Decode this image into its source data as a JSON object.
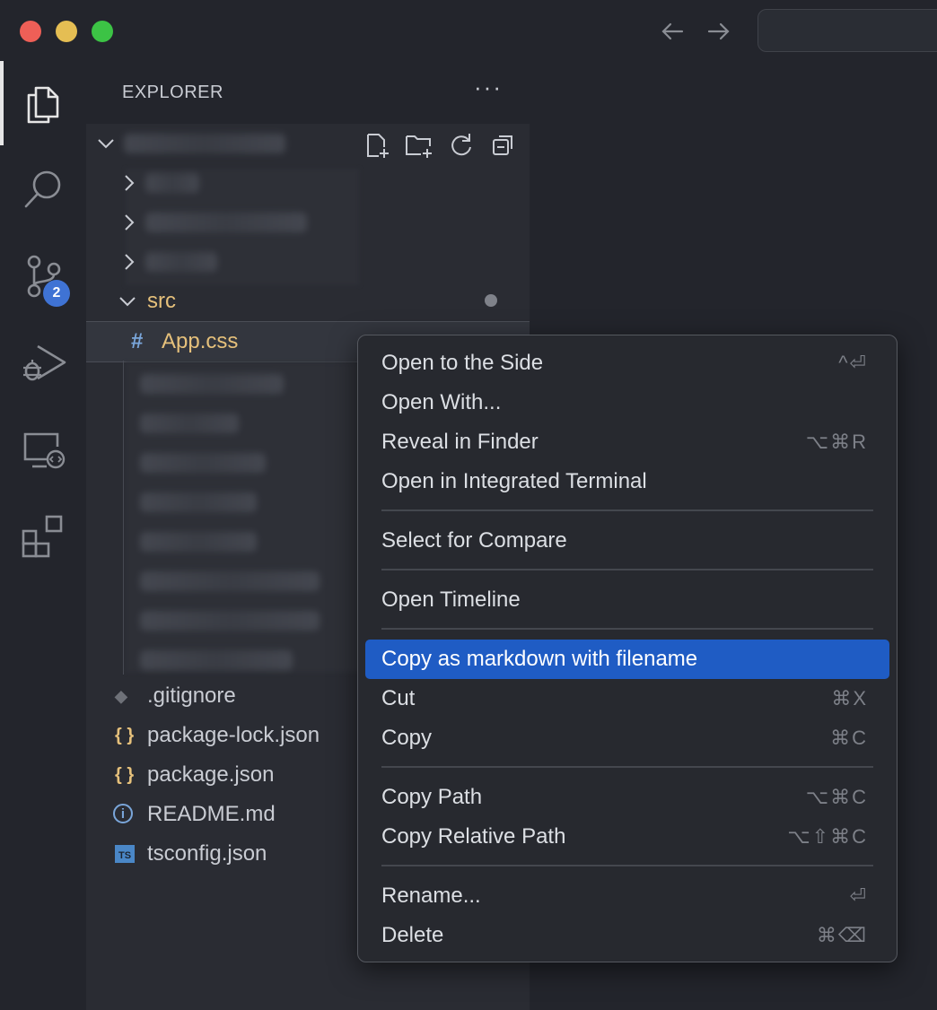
{
  "sidebar": {
    "title": "EXPLORER",
    "more": "···",
    "src_folder": "src",
    "selected_file": {
      "icon": "#",
      "name": "App.css"
    },
    "files": [
      {
        "icon": "◆",
        "name": ".gitignore",
        "icon_name": "git-icon"
      },
      {
        "icon": "{ }",
        "name": "package-lock.json",
        "icon_name": "json-icon"
      },
      {
        "icon": "{ }",
        "name": "package.json",
        "icon_name": "json-icon"
      },
      {
        "icon": "i",
        "name": "README.md",
        "icon_name": "info-icon"
      },
      {
        "icon": "TS",
        "name": "tsconfig.json",
        "icon_name": "typescript-icon"
      }
    ]
  },
  "activity_bar": {
    "source_control_badge": "2"
  },
  "context_menu": {
    "items": [
      {
        "label": "Open to the Side",
        "shortcut": "^⏎"
      },
      {
        "label": "Open With...",
        "shortcut": ""
      },
      {
        "label": "Reveal in Finder",
        "shortcut": "⌥⌘R"
      },
      {
        "label": "Open in Integrated Terminal",
        "shortcut": ""
      },
      {
        "label": "Select for Compare",
        "shortcut": ""
      },
      {
        "label": "Open Timeline",
        "shortcut": ""
      },
      {
        "label": "Copy as markdown with filename",
        "shortcut": ""
      },
      {
        "label": "Cut",
        "shortcut": "⌘X"
      },
      {
        "label": "Copy",
        "shortcut": "⌘C"
      },
      {
        "label": "Copy Path",
        "shortcut": "⌥⌘C"
      },
      {
        "label": "Copy Relative Path",
        "shortcut": "⌥⇧⌘C"
      },
      {
        "label": "Rename...",
        "shortcut": "⏎"
      },
      {
        "label": "Delete",
        "shortcut": "⌘⌫"
      }
    ]
  },
  "colors": {
    "highlight": "#1f5cc4",
    "badge": "#3f73d4",
    "folder_text": "#e5c07b",
    "background": "#23252c"
  }
}
